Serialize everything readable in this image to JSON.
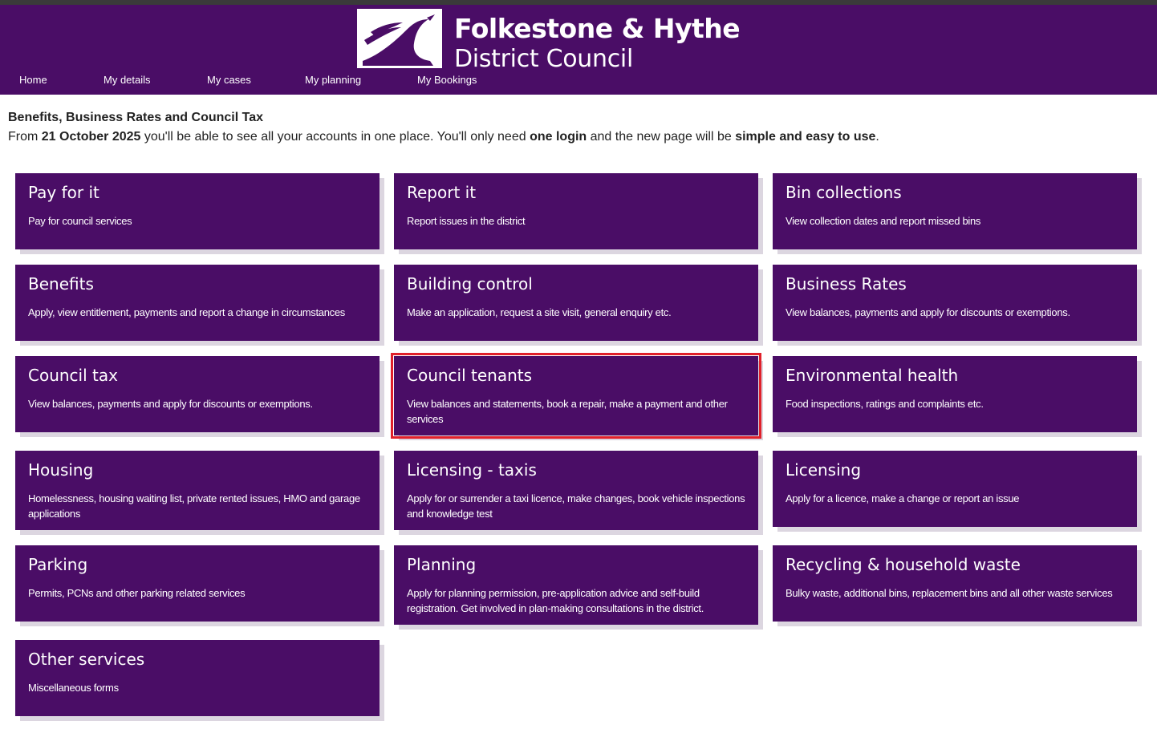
{
  "header": {
    "logo_line1": "Folkestone & Hythe",
    "logo_line2": "District Council",
    "nav": [
      {
        "label": "Home"
      },
      {
        "label": "My details"
      },
      {
        "label": "My cases"
      },
      {
        "label": "My planning"
      },
      {
        "label": "My Bookings"
      }
    ]
  },
  "notice": {
    "title": "Benefits, Business Rates and Council Tax",
    "text_parts": [
      "From ",
      "21 October 2025",
      " you'll be able to see all your accounts in one place. You'll only need ",
      "one login",
      " and the new page will be ",
      "simple and easy to use",
      "."
    ]
  },
  "cards": [
    {
      "title": "Pay for it",
      "desc": "Pay for council services"
    },
    {
      "title": "Report it",
      "desc": "Report issues in the district"
    },
    {
      "title": "Bin collections",
      "desc": "View collection dates and report missed bins"
    },
    {
      "title": "Benefits",
      "desc": "Apply, view entitlement, payments and report a change in circumstances"
    },
    {
      "title": "Building control",
      "desc": "Make an application, request a site visit, general enquiry etc."
    },
    {
      "title": "Business Rates",
      "desc": "View balances, payments and apply for discounts or exemptions."
    },
    {
      "title": "Council tax",
      "desc": "View balances, payments and apply for discounts or exemptions."
    },
    {
      "title": "Council tenants",
      "desc": "View balances and statements, book a repair, make a payment and other services"
    },
    {
      "title": "Environmental health",
      "desc": "Food inspections, ratings and complaints etc."
    },
    {
      "title": "Housing",
      "desc": "Homelessness, housing waiting list, private rented issues, HMO and garage applications"
    },
    {
      "title": "Licensing - taxis",
      "desc": "Apply for or surrender a taxi licence, make changes, book vehicle inspections and knowledge test"
    },
    {
      "title": "Licensing",
      "desc": "Apply for a licence, make a change or report an issue"
    },
    {
      "title": "Parking",
      "desc": "Permits, PCNs and other parking related services"
    },
    {
      "title": "Planning",
      "desc": "Apply for planning permission, pre-application advice and self-build registration. Get involved in plan-making consultations in the district."
    },
    {
      "title": "Recycling & household waste",
      "desc": "Bulky waste, additional bins, replacement bins and all other waste services"
    },
    {
      "title": "Other services",
      "desc": "Miscellaneous forms"
    }
  ],
  "colors": {
    "brand_purple": "#4a0d66",
    "highlight_red": "#e0202a"
  }
}
